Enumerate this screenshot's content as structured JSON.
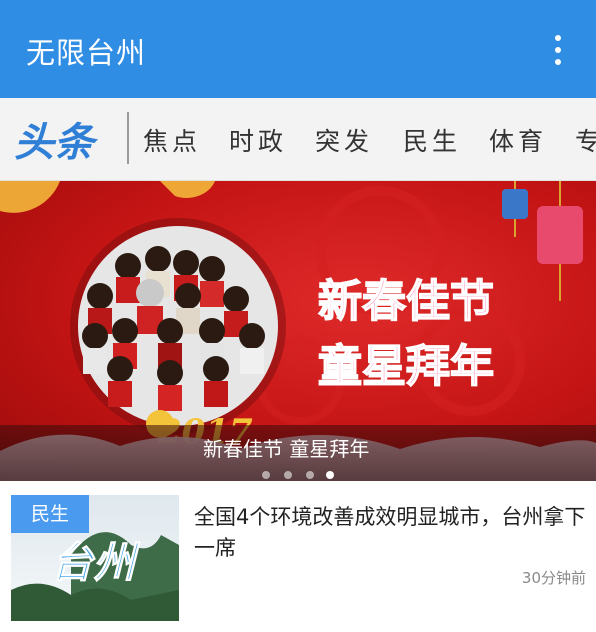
{
  "app_bar": {
    "title": "无限台州",
    "overflow_icon": "more-vert-icon",
    "color": "#2f8de4"
  },
  "tabs": {
    "brand_label": "头条",
    "items": [
      "焦点",
      "时政",
      "突发",
      "民生",
      "体育",
      "专"
    ]
  },
  "banner": {
    "caption": "新春佳节 童星拜年",
    "headline_line1": "新春佳节",
    "headline_line2": "童星拜年",
    "year_art": "2017",
    "page_dots": 4,
    "active_dot": 3
  },
  "news": [
    {
      "category_badge": "民生",
      "thumb_text": "台州",
      "title": "全国4个环境改善成效明显城市，台州拿下一席",
      "time": "30分钟前"
    }
  ]
}
